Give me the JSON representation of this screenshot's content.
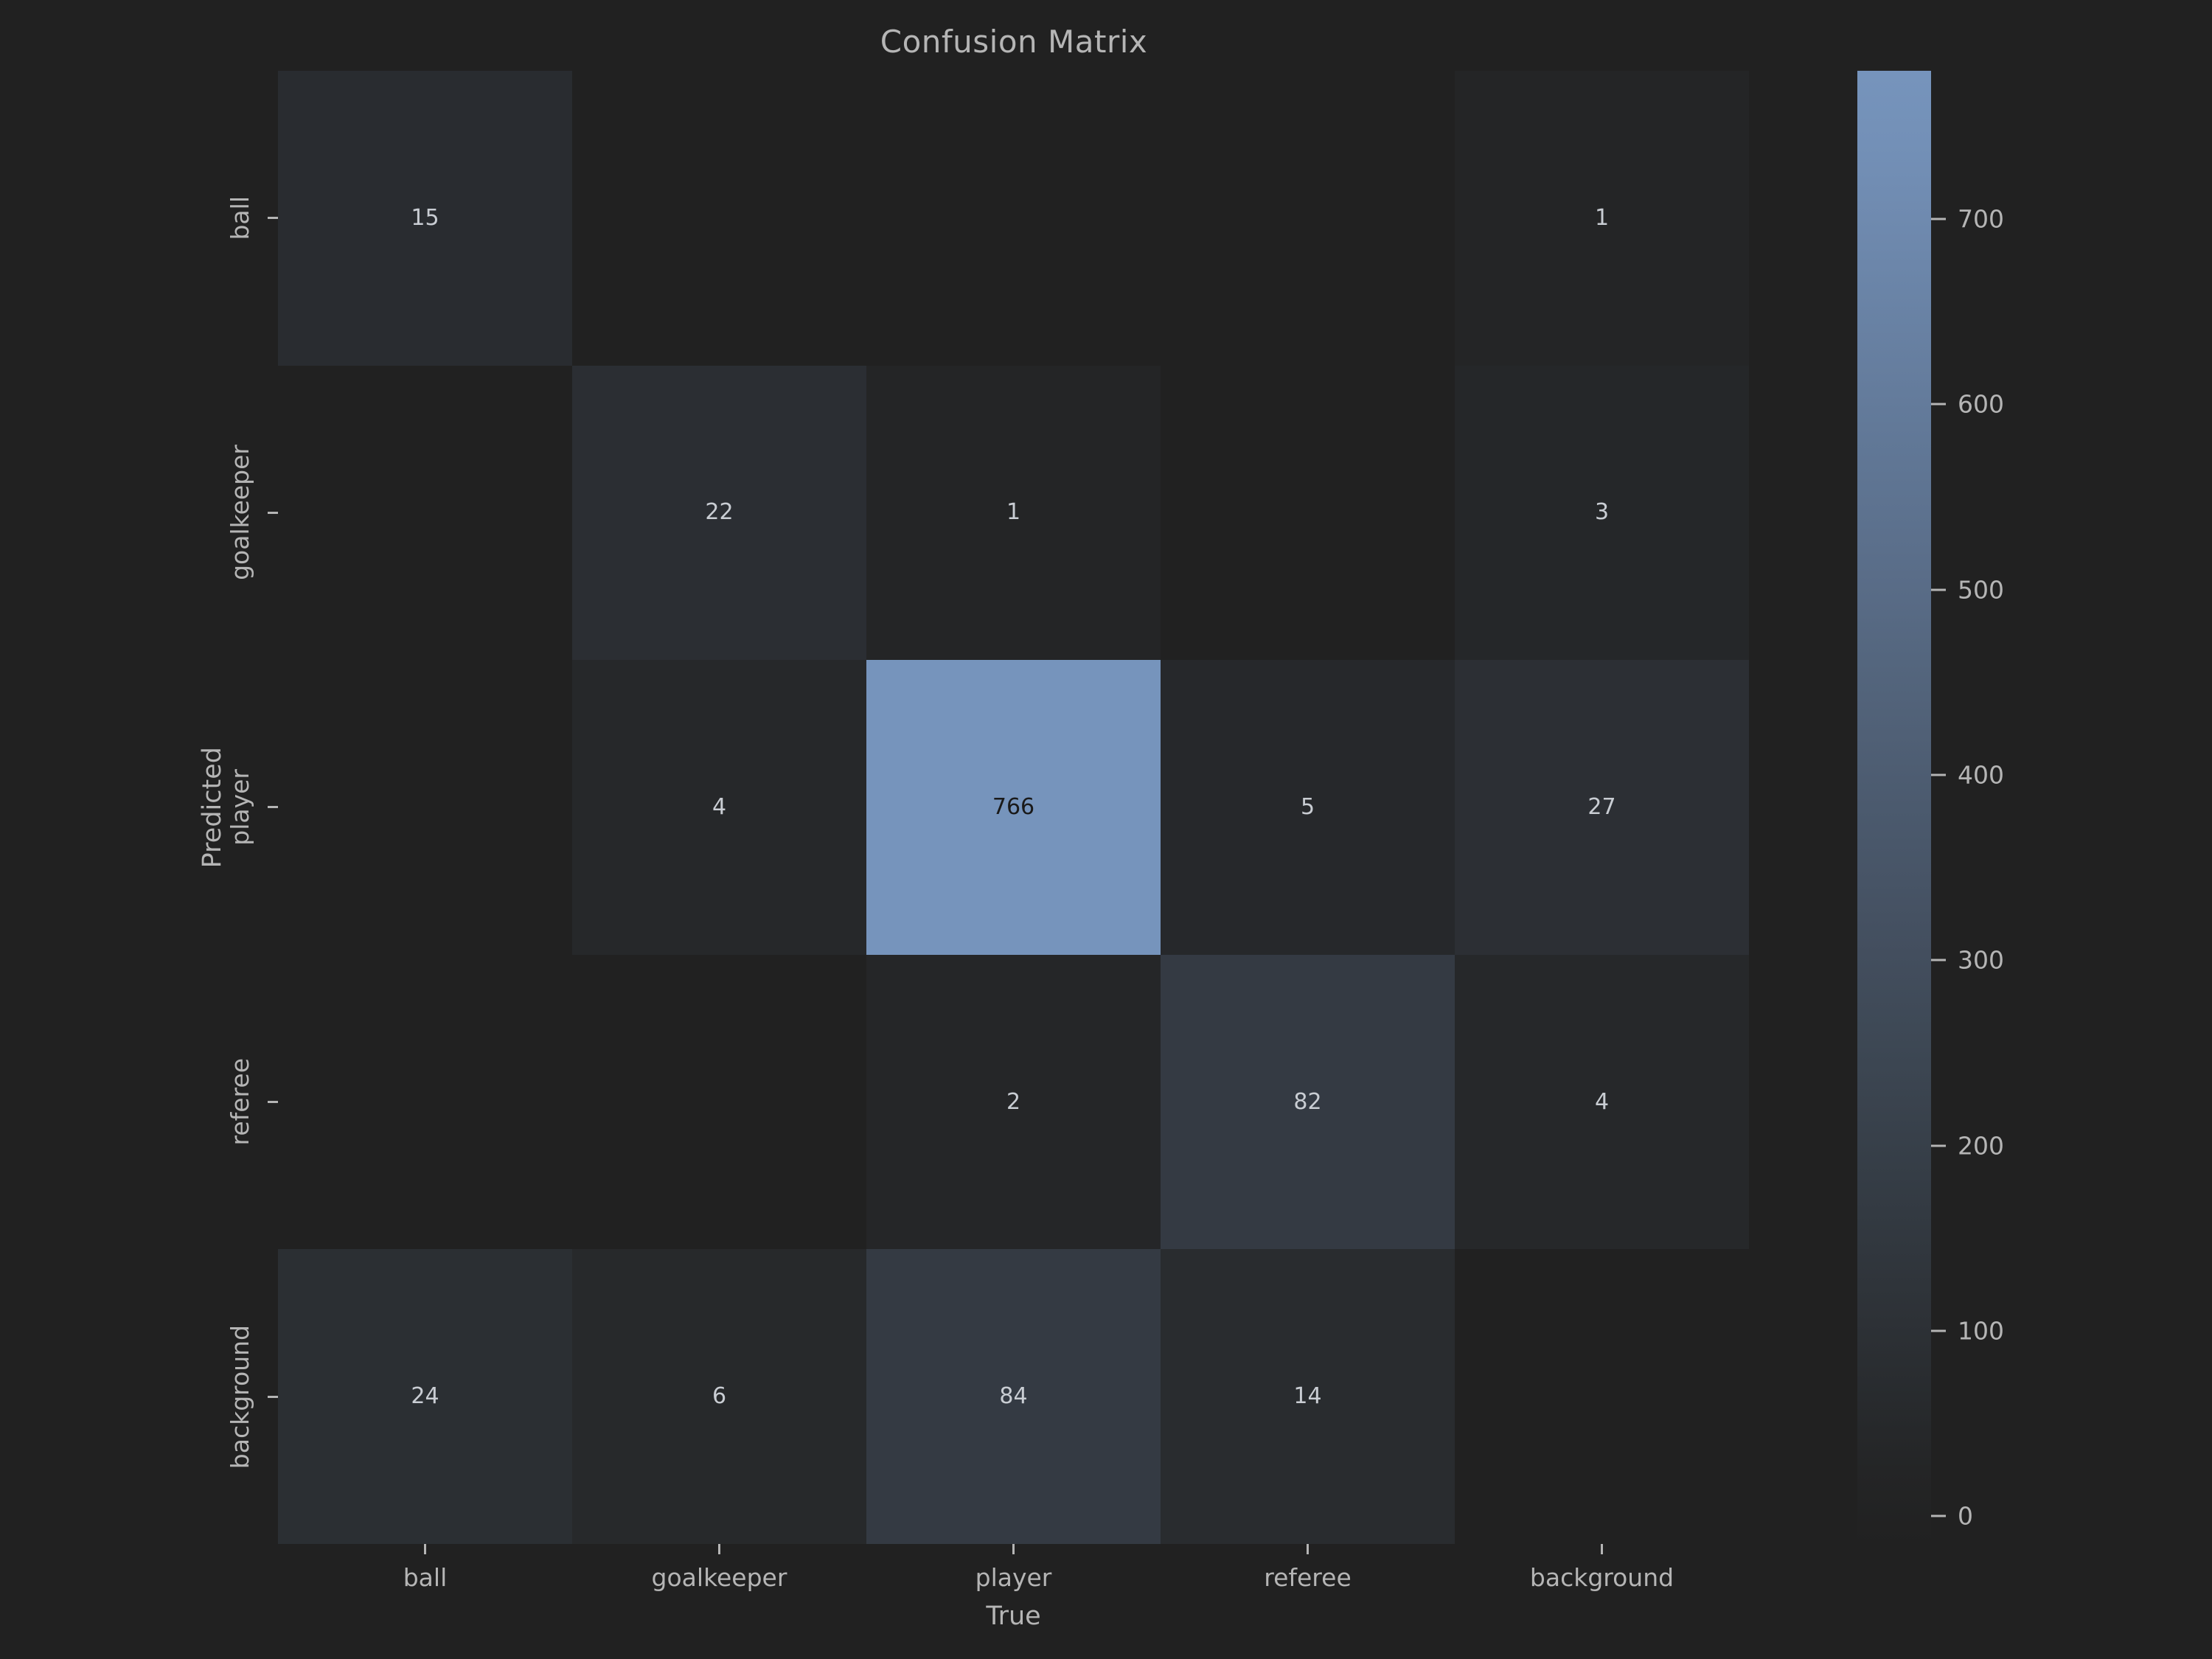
{
  "figure": {
    "background_color": "#212121",
    "text_color": "#b5b5b5",
    "title": "Confusion Matrix"
  },
  "chart_data": {
    "type": "heatmap",
    "title": "Confusion Matrix",
    "xlabel": "True",
    "ylabel": "Predicted",
    "x_categories": [
      "ball",
      "goalkeeper",
      "player",
      "referee",
      "background"
    ],
    "y_categories": [
      "ball",
      "goalkeeper",
      "player",
      "referee",
      "background"
    ],
    "grid": false,
    "legend": "colorbar-right",
    "colormap": {
      "low_color": "#212121",
      "high_color": "#7694bc",
      "vmin": 0,
      "vmax": 766
    },
    "colorbar": {
      "ticks": [
        700,
        600,
        500,
        400,
        300,
        200,
        100,
        0
      ],
      "tick_labels": [
        "700",
        "600",
        "500",
        "400",
        "300",
        "200",
        "100",
        "0"
      ],
      "range": [
        -15,
        780
      ]
    },
    "rows": [
      {
        "label": "ball",
        "cells": [
          {
            "value": 15,
            "text": "15"
          },
          {
            "value": 0,
            "text": ""
          },
          {
            "value": 0,
            "text": ""
          },
          {
            "value": 0,
            "text": ""
          },
          {
            "value": 1,
            "text": "1"
          }
        ]
      },
      {
        "label": "goalkeeper",
        "cells": [
          {
            "value": 0,
            "text": ""
          },
          {
            "value": 22,
            "text": "22"
          },
          {
            "value": 1,
            "text": "1"
          },
          {
            "value": 0,
            "text": ""
          },
          {
            "value": 3,
            "text": "3"
          }
        ]
      },
      {
        "label": "player",
        "cells": [
          {
            "value": 0,
            "text": ""
          },
          {
            "value": 4,
            "text": "4"
          },
          {
            "value": 766,
            "text": "766"
          },
          {
            "value": 5,
            "text": "5"
          },
          {
            "value": 27,
            "text": "27"
          }
        ]
      },
      {
        "label": "referee",
        "cells": [
          {
            "value": 0,
            "text": ""
          },
          {
            "value": 0,
            "text": ""
          },
          {
            "value": 2,
            "text": "2"
          },
          {
            "value": 82,
            "text": "82"
          },
          {
            "value": 4,
            "text": "4"
          }
        ]
      },
      {
        "label": "background",
        "cells": [
          {
            "value": 24,
            "text": "24"
          },
          {
            "value": 6,
            "text": "6"
          },
          {
            "value": 84,
            "text": "84"
          },
          {
            "value": 14,
            "text": "14"
          },
          {
            "value": 0,
            "text": ""
          }
        ]
      }
    ]
  }
}
